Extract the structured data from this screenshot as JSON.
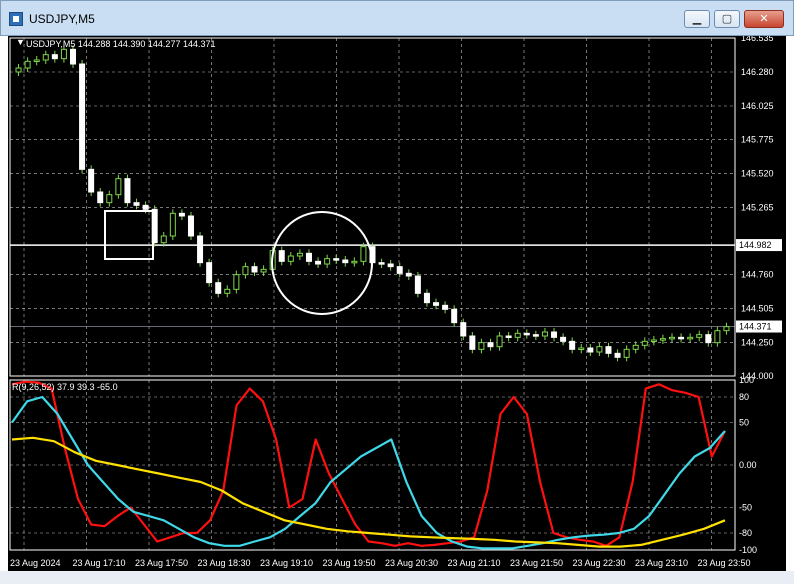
{
  "window": {
    "title": "USDJPY,M5",
    "buttons": [
      "minimize",
      "maximize",
      "close"
    ]
  },
  "chart_info": "USDJPY,M5  144.288 144.390 144.277 144.371",
  "indicator_info": "R(9,26,52) 37.9 39.3 -65.0",
  "colors": {
    "background": "#000000",
    "grid": "#c0c0c0",
    "candle": "#7fd84a",
    "rsi_fast": "#ff1010",
    "rsi_mid": "#3fd8e8",
    "rsi_slow": "#ffe000",
    "annotation": "#ffffff"
  },
  "price_axis": {
    "ticks": [
      "146.535",
      "146.280",
      "146.025",
      "145.775",
      "145.520",
      "145.265",
      "144.760",
      "144.505",
      "144.250",
      "144.000"
    ],
    "tick_values": [
      146.535,
      146.28,
      146.025,
      145.775,
      145.52,
      145.265,
      144.76,
      144.505,
      144.25,
      144.0
    ],
    "range": [
      144.0,
      146.535
    ],
    "horizontal_line": {
      "label": "144.982",
      "value": 144.982
    },
    "current_price": {
      "label": "144.371",
      "value": 144.371
    }
  },
  "indicator_axis": {
    "ticks": [
      "100",
      "80",
      "50",
      "0.00",
      "-50",
      "-80",
      "-100"
    ],
    "tick_values": [
      100,
      80,
      50,
      0,
      -50,
      -80,
      -100
    ],
    "range": [
      -100,
      100
    ]
  },
  "time_axis": {
    "labels": [
      "23 Aug 2024",
      "23 Aug 17:10",
      "23 Aug 17:50",
      "23 Aug 18:30",
      "23 Aug 19:10",
      "23 Aug 19:50",
      "23 Aug 20:30",
      "23 Aug 21:10",
      "23 Aug 21:50",
      "23 Aug 22:30",
      "23 Aug 23:10",
      "23 Aug 23:50"
    ]
  },
  "chart_data": {
    "type": "candlestick",
    "symbol": "USDJPY",
    "timeframe": "M5",
    "ylim": [
      144.0,
      146.535
    ],
    "closes": [
      146.31,
      146.36,
      146.37,
      146.41,
      146.38,
      146.45,
      146.34,
      145.55,
      145.38,
      145.3,
      145.36,
      145.48,
      145.3,
      145.28,
      145.25,
      145.0,
      145.05,
      145.22,
      145.2,
      145.05,
      144.85,
      144.7,
      144.62,
      144.65,
      144.76,
      144.82,
      144.78,
      144.8,
      144.94,
      144.86,
      144.9,
      144.92,
      144.86,
      144.84,
      144.88,
      144.87,
      144.85,
      144.86,
      144.97,
      144.85,
      144.84,
      144.82,
      144.77,
      144.75,
      144.62,
      144.55,
      144.53,
      144.5,
      144.4,
      144.3,
      144.2,
      144.25,
      144.22,
      144.3,
      144.29,
      144.32,
      144.31,
      144.3,
      144.33,
      144.29,
      144.26,
      144.2,
      144.21,
      144.18,
      144.22,
      144.17,
      144.14,
      144.2,
      144.23,
      144.26,
      144.27,
      144.28,
      144.29,
      144.28,
      144.29,
      144.31,
      144.25,
      144.34,
      144.37
    ],
    "series": [
      {
        "name": "R(9)",
        "values": [
          95,
          98,
          97,
          90,
          20,
          -40,
          -70,
          -72,
          -60,
          -50,
          -70,
          -90,
          -85,
          -80,
          -80,
          -65,
          -30,
          70,
          90,
          75,
          30,
          -50,
          -40,
          30,
          -10,
          -40,
          -70,
          -90,
          -92,
          -95,
          -92,
          -95,
          -94,
          -92,
          -90,
          -85,
          -30,
          60,
          80,
          60,
          -20,
          -80,
          -85,
          -88,
          -90,
          -95,
          -85,
          -20,
          90,
          95,
          88,
          85,
          80,
          10,
          40
        ]
      },
      {
        "name": "R(26)",
        "values": [
          50,
          75,
          80,
          60,
          30,
          0,
          -20,
          -40,
          -55,
          -60,
          -65,
          -75,
          -85,
          -92,
          -95,
          -95,
          -90,
          -85,
          -75,
          -60,
          -45,
          -20,
          -5,
          10,
          20,
          30,
          -20,
          -60,
          -80,
          -90,
          -96,
          -98,
          -98,
          -98,
          -95,
          -92,
          -88,
          -85,
          -83,
          -82,
          -80,
          -75,
          -60,
          -35,
          -10,
          10,
          20,
          40
        ]
      },
      {
        "name": "R(52)",
        "values": [
          30,
          32,
          28,
          15,
          5,
          0,
          -5,
          -10,
          -15,
          -20,
          -30,
          -45,
          -55,
          -65,
          -70,
          -75,
          -78,
          -80,
          -82,
          -84,
          -85,
          -86,
          -87,
          -88,
          -90,
          -91,
          -92,
          -94,
          -96,
          -96,
          -94,
          -88,
          -82,
          -75,
          -65
        ]
      }
    ]
  }
}
